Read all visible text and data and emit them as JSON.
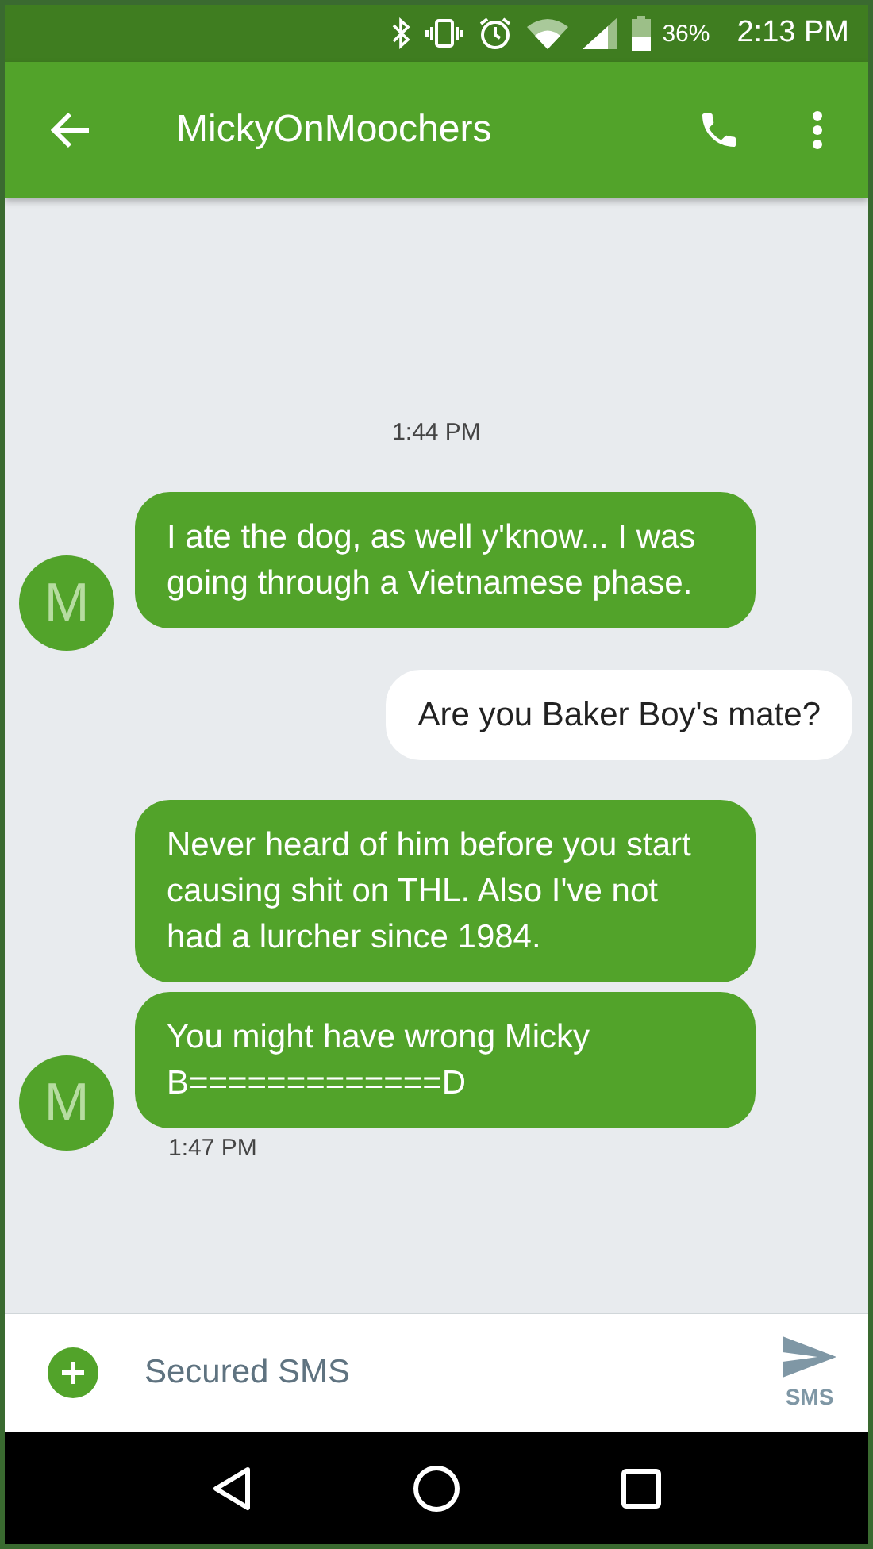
{
  "status_bar": {
    "battery": "36%",
    "time": "2:13 PM"
  },
  "app_bar": {
    "title": "MickyOnMoochers"
  },
  "messages": [
    {
      "kind": "timestamp",
      "text": "1:44 PM"
    },
    {
      "kind": "incoming",
      "text": "I ate the dog, as well y'know... I was going through a Vietnamese phase.",
      "avatar": "M",
      "grouped": false
    },
    {
      "kind": "outgoing",
      "text": "Are you Baker Boy's mate?"
    },
    {
      "kind": "incoming",
      "text": "Never heard of him before you start causing shit on THL. Also I've not had a lurcher since 1984.",
      "grouped": false
    },
    {
      "kind": "incoming",
      "text": "You might have wrong Micky B=============D",
      "avatar": "M",
      "grouped": true
    },
    {
      "kind": "message_time",
      "text": "1:47 PM"
    }
  ],
  "compose": {
    "placeholder": "Secured SMS",
    "send_label": "SMS"
  }
}
